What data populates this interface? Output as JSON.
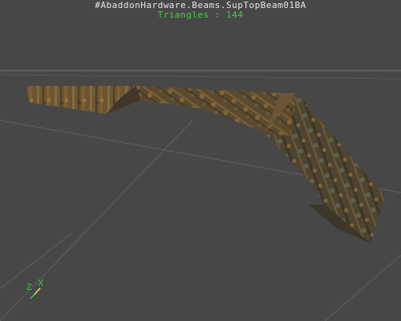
{
  "viewport": {
    "mesh_name": "#AbaddonHardware.Beams.SupTopBeam01BA",
    "triangle_count_text": "Triangles : 144",
    "background_color": "#474747",
    "name_color": "#e6e6e6",
    "stats_color": "#3ed13e"
  },
  "axis_gizmo": {
    "z_label": "Z",
    "x_label": "X",
    "z_color": "#3ed13e",
    "x_color": "#e8e84a"
  },
  "mesh": {
    "icon": "textured-beam-mesh",
    "material": "rusty metal"
  }
}
